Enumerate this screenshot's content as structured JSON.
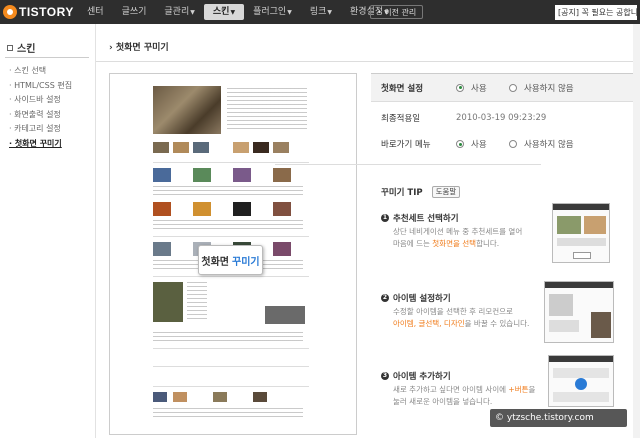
{
  "app": {
    "logo_text": "TISTORY"
  },
  "gnb": {
    "items": [
      {
        "label": "센터",
        "active": false
      },
      {
        "label": "글쓰기",
        "active": false
      },
      {
        "label": "글관리",
        "active": false,
        "dropdown": true
      },
      {
        "label": "스킨",
        "active": true,
        "dropdown": true
      },
      {
        "label": "플러그인",
        "active": false,
        "dropdown": true
      },
      {
        "label": "링크",
        "active": false,
        "dropdown": true
      },
      {
        "label": "환경설정",
        "active": false,
        "dropdown": true
      }
    ],
    "old_admin": "• 이전 관리",
    "notice": "[공지] 꼭 필요는 공합니다."
  },
  "sidebar": {
    "title": "스킨",
    "items": [
      {
        "label": "· 스킨 선택",
        "active": false
      },
      {
        "label": "· HTML/CSS 편집",
        "active": false
      },
      {
        "label": "· 사이드바 설정",
        "active": false
      },
      {
        "label": "· 화면출력 설정",
        "active": false
      },
      {
        "label": "· 카테고리 설정",
        "active": false
      },
      {
        "label": "· 첫화면 꾸미기",
        "active": true
      }
    ]
  },
  "page": {
    "title": "› 첫화면 꾸미기"
  },
  "preview": {
    "tooltip_prefix": "첫화면",
    "tooltip_highlight": "꾸미기"
  },
  "settings": {
    "main_setting": {
      "label": "첫화면 설정",
      "on": "사용",
      "off": "사용하지 않음",
      "selected": "on"
    },
    "last_applied": {
      "label": "최종적용일",
      "value": "2010-03-19 09:23:29"
    },
    "shortcut_menu": {
      "label": "바로가기 메뉴",
      "on": "사용",
      "off": "사용하지 않음",
      "selected": "on"
    }
  },
  "tips": {
    "title": "꾸미기 TIP",
    "help_button": "도움말",
    "items": [
      {
        "num": "1",
        "title": "추천세트 선택하기",
        "desc_1": "상단 네비게이션 메뉴 중 추천세트를 열어",
        "desc_2": "마음에 드는 ",
        "desc_orange": "첫화면을 선택",
        "desc_3": "합니다."
      },
      {
        "num": "2",
        "title": "아이템 설정하기",
        "desc_1": "수정할 아이템을 선택한 후 리모컨으로",
        "desc_orange": "아이템, 글선택, 디자인",
        "desc_3": "을 바꿀 수 있습니다."
      },
      {
        "num": "3",
        "title": "아이템 추가하기",
        "desc_1": "새로 추가하고 싶다면 아이템 사이에 ",
        "desc_orange": "+버튼",
        "desc_2": "을",
        "desc_3": "눌러 새로운 아이템을 넣습니다."
      }
    ]
  },
  "watermark": "© ytzsche.tistory.com",
  "colors": {
    "accent_orange": "#f07b1a",
    "radio_green": "#2b8a3e",
    "topbar": "#2e2e2e"
  }
}
